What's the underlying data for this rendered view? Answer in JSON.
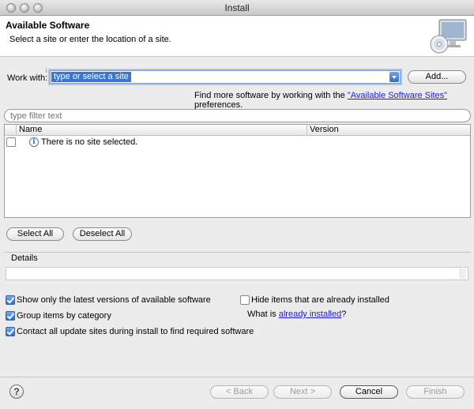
{
  "window": {
    "title": "Install"
  },
  "header": {
    "title": "Available Software",
    "subtitle": "Select a site or enter the location of a site.",
    "icon": "software-install-monitor-cd-icon"
  },
  "work_with": {
    "label": "Work with:",
    "value": "type or select a site",
    "add_label": "Add..."
  },
  "find_more": {
    "prefix": "Find more software by working with the ",
    "link_text": "\"Available Software Sites\"",
    "suffix": " preferences."
  },
  "filter": {
    "placeholder": "type filter text"
  },
  "table": {
    "columns": [
      "Name",
      "Version"
    ],
    "rows": [
      {
        "name": "There is no site selected.",
        "version": "",
        "checked": false,
        "icon": "info-icon"
      }
    ]
  },
  "selection_buttons": {
    "select_all": "Select All",
    "deselect_all": "Deselect All"
  },
  "details": {
    "label": "Details",
    "value": ""
  },
  "options": [
    {
      "label": "Show only the latest versions of available software",
      "checked": true
    },
    {
      "label": "Group items by category",
      "checked": true
    },
    {
      "label": "Contact all update sites during install to find required software",
      "checked": true
    },
    {
      "label": "Hide items that are already installed",
      "checked": false
    }
  ],
  "what_is": {
    "prefix": "What is ",
    "link_text": "already installed",
    "suffix": "?"
  },
  "footer": {
    "back": "< Back",
    "next": "Next >",
    "cancel": "Cancel",
    "finish": "Finish",
    "back_enabled": false,
    "next_enabled": false,
    "finish_enabled": false
  },
  "colors": {
    "selection": "#3875d7",
    "link": "#1a1aee",
    "focus_ring": "#a8c6ef"
  }
}
